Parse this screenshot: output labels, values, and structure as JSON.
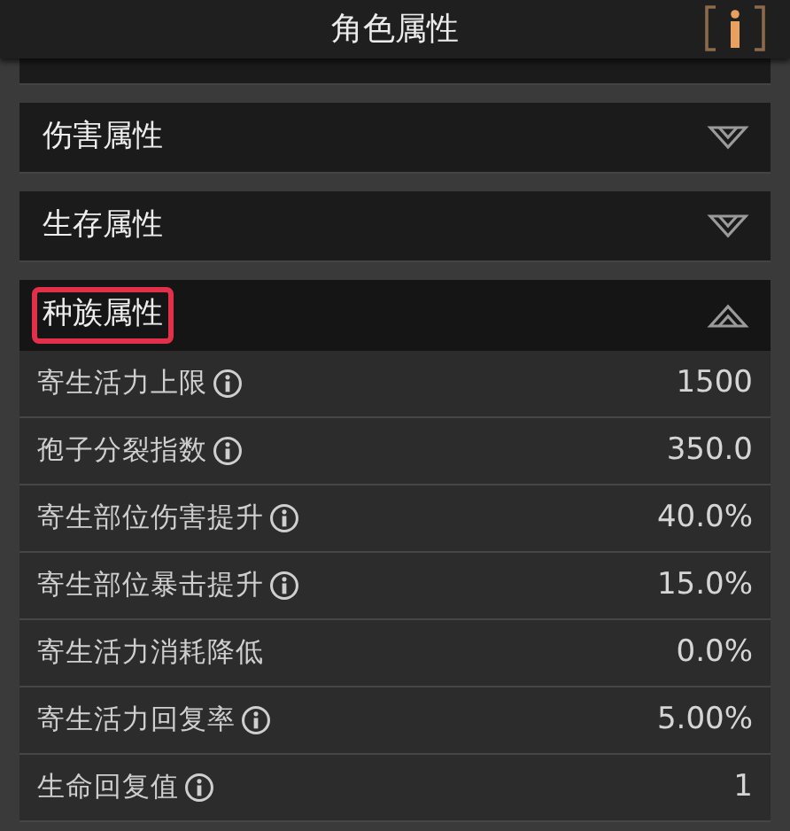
{
  "header": {
    "title": "角色属性"
  },
  "sections": [
    {
      "label": "伤害属性",
      "expanded": false,
      "highlighted": false
    },
    {
      "label": "生存属性",
      "expanded": false,
      "highlighted": false
    },
    {
      "label": "种族属性",
      "expanded": true,
      "highlighted": true,
      "rows": [
        {
          "name": "寄生活力上限",
          "info": true,
          "value": "1500"
        },
        {
          "name": "孢子分裂指数",
          "info": true,
          "value": "350.0"
        },
        {
          "name": "寄生部位伤害提升",
          "info": true,
          "value": "40.0%"
        },
        {
          "name": "寄生部位暴击提升",
          "info": true,
          "value": "15.0%"
        },
        {
          "name": "寄生活力消耗降低",
          "info": false,
          "value": "0.0%"
        },
        {
          "name": "寄生活力回复率",
          "info": true,
          "value": "5.00%"
        },
        {
          "name": "生命回复值",
          "info": true,
          "value": "1"
        }
      ]
    }
  ]
}
